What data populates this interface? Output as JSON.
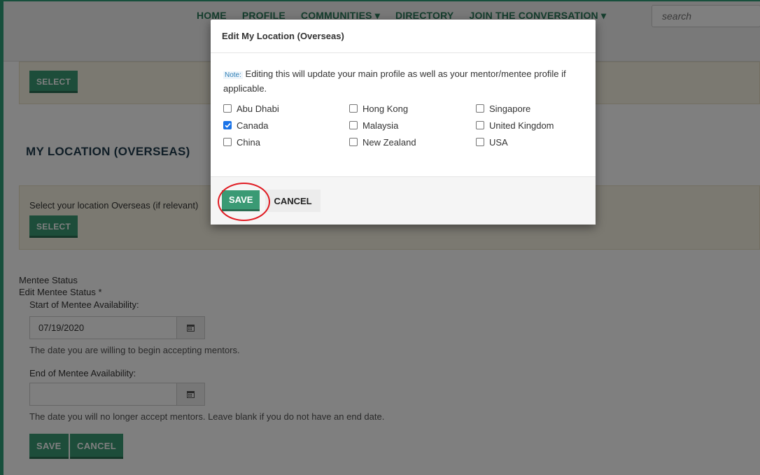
{
  "nav": {
    "items": [
      "HOME",
      "PROFILE",
      "COMMUNITIES ▾",
      "DIRECTORY",
      "JOIN THE CONVERSATION ▾"
    ],
    "search_placeholder": "search"
  },
  "page": {
    "top_select_label": "SELECT",
    "section_title": "MY LOCATION (OVERSEAS)",
    "overseas_prompt": "Select your location Overseas (if relevant)",
    "overseas_select_label": "SELECT",
    "mentee_status": "Mentee Status",
    "edit_mentee_status": "Edit Mentee Status *",
    "start_label": "Start of Mentee Availability:",
    "start_value": "07/19/2020",
    "start_help": "The date you are willing to begin accepting mentors.",
    "end_label": "End of Mentee Availability:",
    "end_value": "",
    "end_help": "The date you will no longer accept mentors. Leave blank if you do not have an end date.",
    "save_label": "SAVE",
    "cancel_label": "CANCEL"
  },
  "modal": {
    "title": "Edit My Location (Overseas)",
    "note_label": "Note:",
    "note_text": "Editing this will update your main profile as well as your mentor/mentee profile if applicable.",
    "options": [
      {
        "label": "Abu Dhabi",
        "checked": false
      },
      {
        "label": "Hong Kong",
        "checked": false
      },
      {
        "label": "Singapore",
        "checked": false
      },
      {
        "label": "Canada",
        "checked": true
      },
      {
        "label": "Malaysia",
        "checked": false
      },
      {
        "label": "United Kingdom",
        "checked": false
      },
      {
        "label": "China",
        "checked": false
      },
      {
        "label": "New Zealand",
        "checked": false
      },
      {
        "label": "USA",
        "checked": false
      }
    ],
    "save_label": "SAVE",
    "cancel_label": "CANCEL"
  },
  "colors": {
    "brand_green": "#3a9a74",
    "nav_text": "#2a7a5b",
    "highlight_circle": "#e01b22",
    "checkbox_checked": "#1a73e8"
  }
}
